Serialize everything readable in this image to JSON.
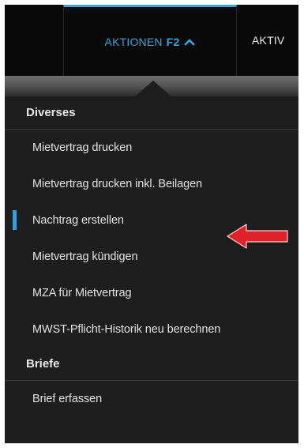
{
  "tabs": {
    "aktionen_label": "AKTIONEN",
    "aktionen_key": "F2",
    "aktiv_label": "AKTIV"
  },
  "menu": {
    "section1": "Diverses",
    "items1": [
      "Mietvertrag drucken",
      "Mietvertrag drucken inkl. Beilagen",
      "Nachtrag erstellen",
      "Mietvertrag kündigen",
      "MZA für Mietvertrag",
      "MWST-Pflicht-Historik neu berechnen"
    ],
    "section2": "Briefe",
    "items2": [
      "Brief erfassen"
    ]
  },
  "colors": {
    "accent": "#3aa2d6",
    "annotation_arrow": "#e0222a"
  }
}
